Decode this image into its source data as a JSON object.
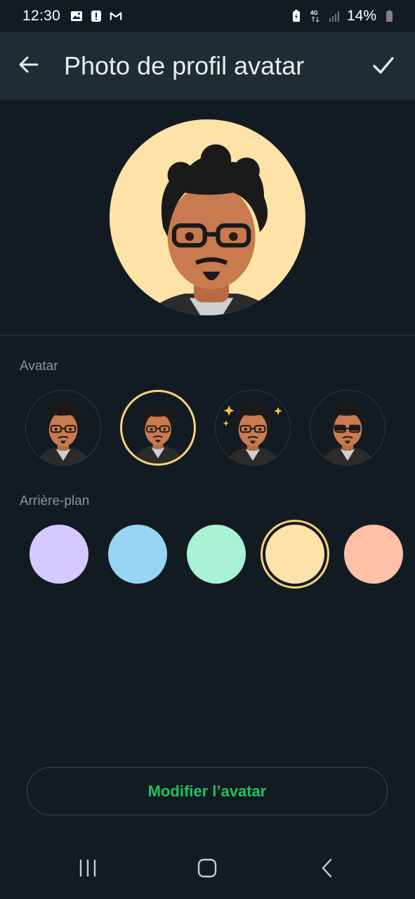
{
  "status_bar": {
    "time": "12:30",
    "battery_percent": "14%",
    "network": "4G",
    "left_icons": [
      "image-icon",
      "alert-icon",
      "gmail-icon"
    ],
    "right_icons": [
      "battery-saver-icon",
      "4g-data-icon",
      "signal-icon",
      "battery-icon"
    ]
  },
  "app_bar": {
    "title": "Photo de profil avatar",
    "back_icon": "arrow-left-icon",
    "confirm_icon": "checkmark-icon"
  },
  "sections": {
    "avatar_label": "Avatar",
    "background_label": "Arrière-plan"
  },
  "avatar_options": [
    {
      "pose": "glasses-worried",
      "selected": false
    },
    {
      "pose": "glasses-neutral",
      "selected": true
    },
    {
      "pose": "sparkles-hand-on-chest",
      "selected": false
    },
    {
      "pose": "sunglasses-smirk",
      "selected": false
    }
  ],
  "background_options": [
    {
      "color": "#d7c8ff",
      "selected": false
    },
    {
      "color": "#98d4f4",
      "selected": false
    },
    {
      "color": "#a9f2d3",
      "selected": false
    },
    {
      "color": "#ffe2a8",
      "selected": true
    },
    {
      "color": "#ffc0a8",
      "selected": false
    }
  ],
  "actions": {
    "edit_avatar": "Modifier l’avatar"
  },
  "colors": {
    "background": "#121b22",
    "app_bar": "#1f2c34",
    "accent_green": "#21c063",
    "selection_ring": "#ffd279",
    "secondary_text": "#8696a0"
  },
  "nav_bar": {
    "recents_icon": "recents-icon",
    "home_icon": "home-icon",
    "back_icon": "nav-back-icon"
  }
}
